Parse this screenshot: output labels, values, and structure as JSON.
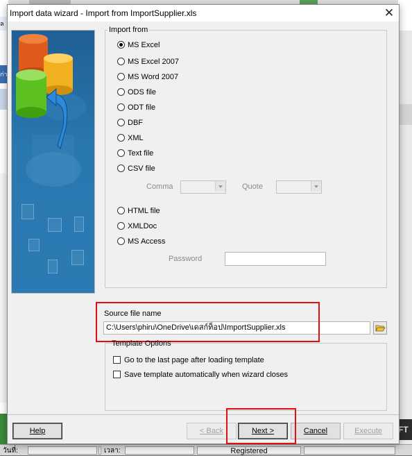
{
  "background": {
    "status_date_label": "วันที่:",
    "status_time_label": "เวลา:",
    "status_registered": "Registered",
    "bg_left_a": "ล",
    "bg_left_b": "ก่า",
    "bg_right_fragment": "FT"
  },
  "window": {
    "title": "Import data wizard - Import from ImportSupplier.xls",
    "close_glyph": "✕"
  },
  "import_from": {
    "legend": "Import from",
    "options": [
      {
        "label": "MS Excel",
        "selected": true
      },
      {
        "label": "MS Excel 2007",
        "selected": false
      },
      {
        "label": "MS Word 2007",
        "selected": false
      },
      {
        "label": "ODS file",
        "selected": false
      },
      {
        "label": "ODT file",
        "selected": false
      },
      {
        "label": "DBF",
        "selected": false
      },
      {
        "label": "XML",
        "selected": false
      },
      {
        "label": "Text file",
        "selected": false
      },
      {
        "label": "CSV file",
        "selected": false
      },
      {
        "label": "HTML file",
        "selected": false
      },
      {
        "label": "XMLDoc",
        "selected": false
      },
      {
        "label": "MS Access",
        "selected": false
      }
    ],
    "comma_label": "Comma",
    "quote_label": "Quote",
    "comma_value": "",
    "quote_value": "",
    "password_label": "Password",
    "password_value": ""
  },
  "source": {
    "label": "Source file name",
    "path": "C:\\Users\\phiru\\OneDrive\\เดสก์ท็อป\\ImportSupplier.xls"
  },
  "template": {
    "legend": "Template Options",
    "options": [
      {
        "label": "Go to the last page after loading template",
        "checked": false
      },
      {
        "label": "Save template automatically when wizard closes",
        "checked": false
      }
    ]
  },
  "buttons": {
    "help": "Help",
    "back": "< Back",
    "next": "Next >",
    "cancel": "Cancel",
    "execute": "Execute"
  },
  "icons": {
    "close": "close-icon",
    "browse": "folder-open-icon",
    "side_image": "database-import-illustration"
  },
  "colors": {
    "highlight": "#e01010",
    "side_panel": "#2a78b0"
  }
}
